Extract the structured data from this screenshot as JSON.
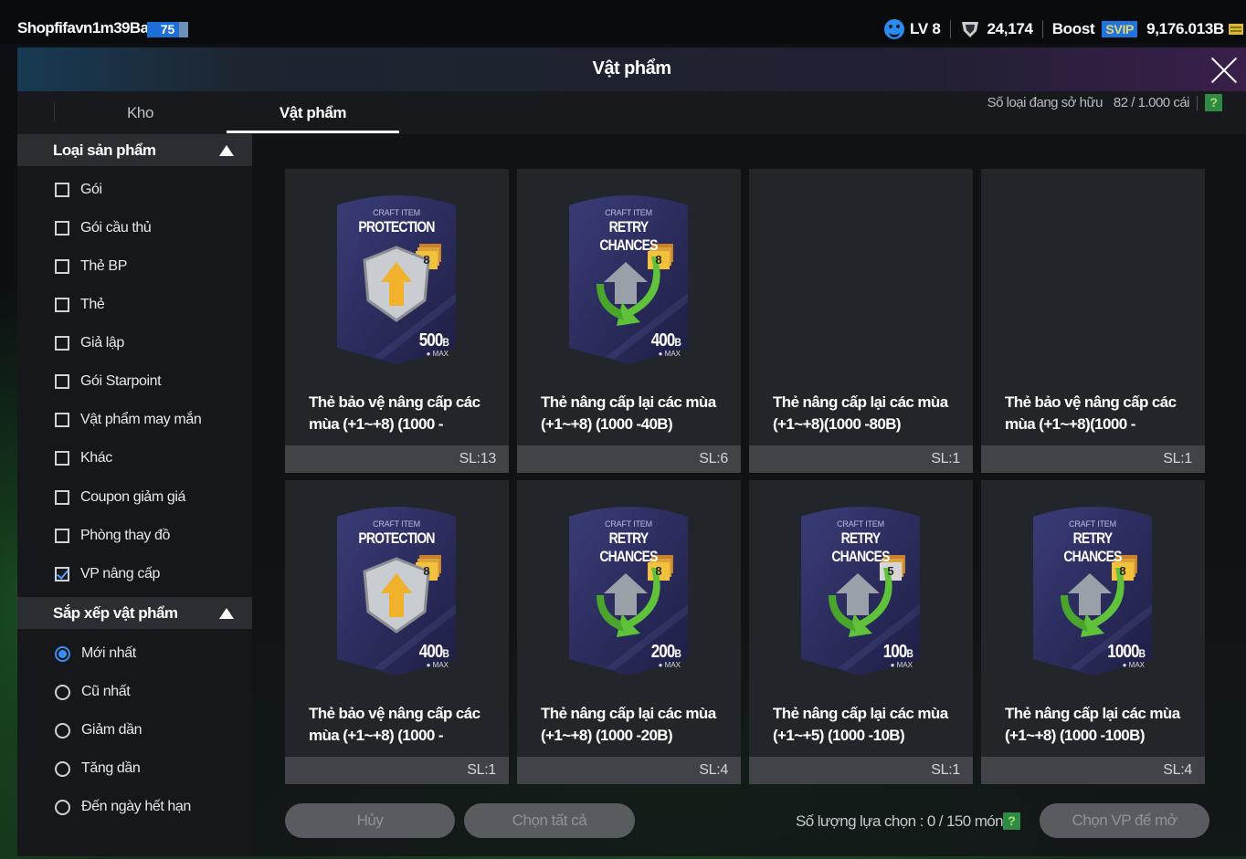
{
  "user": {
    "name": "Shopfifavn1m39Ba",
    "level_badge": "75"
  },
  "status": {
    "lv": "LV 8",
    "points": "24,174",
    "boost_label": "Boost",
    "svip": "SVIP",
    "bp": "9,176.013B"
  },
  "window": {
    "title": "Vật phẩm"
  },
  "tabs": [
    {
      "label": "Kho"
    },
    {
      "label": "Vật phẩm",
      "active": true
    }
  ],
  "filter": {
    "header": "Loại sản phẩm",
    "options": [
      {
        "label": "Gói",
        "checked": false
      },
      {
        "label": "Gói cầu thủ",
        "checked": false
      },
      {
        "label": "Thẻ BP",
        "checked": false
      },
      {
        "label": "Thẻ",
        "checked": false
      },
      {
        "label": "Giả lập",
        "checked": false
      },
      {
        "label": "Gói Starpoint",
        "checked": false
      },
      {
        "label": "Vật phẩm may mắn",
        "checked": false
      },
      {
        "label": "Khác",
        "checked": false
      },
      {
        "label": "Coupon giảm giá",
        "checked": false
      },
      {
        "label": "Phòng thay đồ",
        "checked": false
      },
      {
        "label": "VP nâng cấp",
        "checked": true
      }
    ]
  },
  "sort": {
    "header": "Sắp xếp vật phẩm",
    "options": [
      {
        "label": "Mới nhất",
        "selected": true
      },
      {
        "label": "Cũ nhất",
        "selected": false
      },
      {
        "label": "Giảm dần",
        "selected": false
      },
      {
        "label": "Tăng dần",
        "selected": false
      },
      {
        "label": "Đến ngày hết hạn",
        "selected": false
      }
    ]
  },
  "owned": {
    "label": "Số loại đang sở hữu",
    "value": "82 / 1.000 cái",
    "help": "?"
  },
  "items": [
    {
      "name": "Thẻ bảo vệ nâng cấp các mùa (+1~+8) (1000 -",
      "qty": "SL:13",
      "craft": "CRAFT ITEM",
      "type": "PROTECTION",
      "level": "8",
      "value": "500",
      "unit": "B",
      "max": "MAX",
      "show_art": true
    },
    {
      "name": "Thẻ nâng cấp lại các mùa (+1~+8) (1000 -40B)",
      "qty": "SL:6",
      "craft": "CRAFT ITEM",
      "type": "RETRY CHANCES",
      "level": "8",
      "value": "400",
      "unit": "B",
      "max": "MAX",
      "show_art": true
    },
    {
      "name": "Thẻ nâng cấp lại các mùa (+1~+8)(1000 -80B)",
      "qty": "SL:1",
      "show_art": false
    },
    {
      "name": "Thẻ bảo vệ nâng cấp các mùa (+1~+8)(1000 -",
      "qty": "SL:1",
      "show_art": false
    },
    {
      "name": "Thẻ bảo vệ nâng cấp các mùa (+1~+8) (1000 -",
      "qty": "SL:1",
      "craft": "CRAFT ITEM",
      "type": "PROTECTION",
      "level": "8",
      "value": "400",
      "unit": "B",
      "max": "MAX",
      "show_art": true
    },
    {
      "name": "Thẻ nâng cấp lại các mùa (+1~+8) (1000 -20B)",
      "qty": "SL:4",
      "craft": "CRAFT ITEM",
      "type": "RETRY CHANCES",
      "level": "8",
      "value": "200",
      "unit": "B",
      "max": "MAX",
      "show_art": true
    },
    {
      "name": "Thẻ nâng cấp lại các mùa (+1~+5) (1000 -10B)",
      "qty": "SL:1",
      "craft": "CRAFT ITEM",
      "type": "RETRY CHANCES",
      "level": "5",
      "value": "100",
      "unit": "B",
      "max": "MAX",
      "show_art": true
    },
    {
      "name": "Thẻ nâng cấp lại các mùa (+1~+8) (1000 -100B)",
      "qty": "SL:4",
      "craft": "CRAFT ITEM",
      "type": "RETRY CHANCES",
      "level": "8",
      "value": "1000",
      "unit": "B",
      "max": "MAX",
      "show_art": true
    }
  ],
  "bottom": {
    "cancel": "Hủy",
    "select_all": "Chọn tất cả",
    "selection_label": "Số lượng lựa chọn : 0 / 150 món",
    "help": "?",
    "open": "Chọn VP để mở"
  }
}
